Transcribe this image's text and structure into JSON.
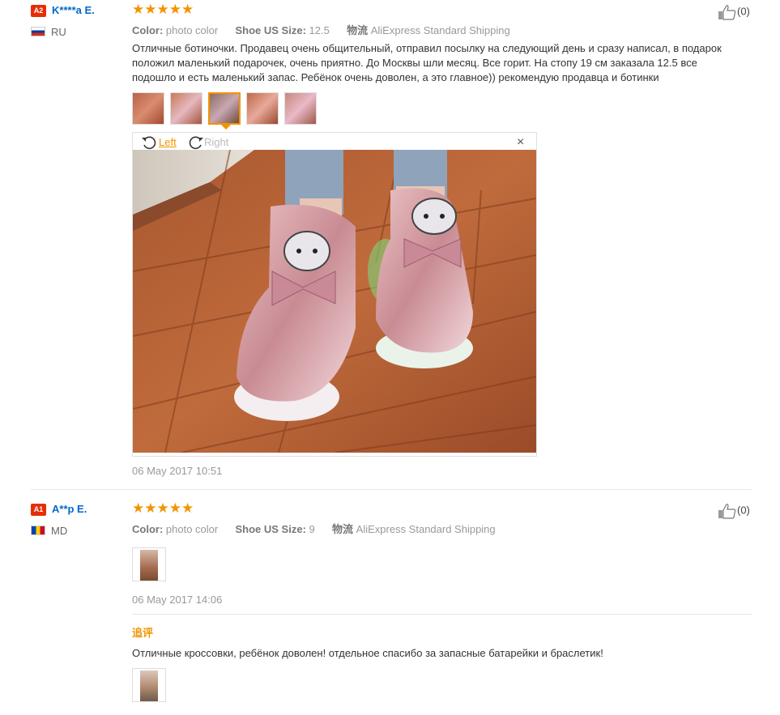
{
  "reviews": [
    {
      "badge": "A2",
      "username": "K****a E.",
      "country": "RU",
      "stars": "★★★★★",
      "color_label": "Color:",
      "color_value": "photo color",
      "size_label": "Shoe US Size:",
      "size_value": "12.5",
      "logistics_label": "物流",
      "logistics_value": "AliExpress Standard Shipping",
      "text": "Отличные ботиночки. Продавец очень общительный, отправил посылку на следующий день и сразу написал, в подарок положил маленький подарочек, очень приятно. До Москвы шли месяц. Все горит. На стопу 19 см заказала 12.5 все подошло и есть маленький запас. Ребёнок очень доволен, а это главное)) рекомендую продавца и ботинки",
      "like_count": "(0)",
      "date": "06 May 2017 10:51",
      "viewer": {
        "left_label": "Left",
        "right_label": "Right",
        "close_label": "×"
      }
    },
    {
      "badge": "A1",
      "username": "A**p E.",
      "country": "MD",
      "stars": "★★★★★",
      "color_label": "Color:",
      "color_value": "photo color",
      "size_label": "Shoe US Size:",
      "size_value": "9",
      "logistics_label": "物流",
      "logistics_value": "AliExpress Standard Shipping",
      "like_count": "(0)",
      "date": "06 May 2017 14:06",
      "followup_title": "追评",
      "followup_text": "Отличные кроссовки, ребёнок доволен! отдельное спасибо за запасные батарейки и браслетик!"
    }
  ],
  "colors": {
    "accent": "#f29400",
    "link": "#0069c8",
    "badge": "#e62e04"
  }
}
